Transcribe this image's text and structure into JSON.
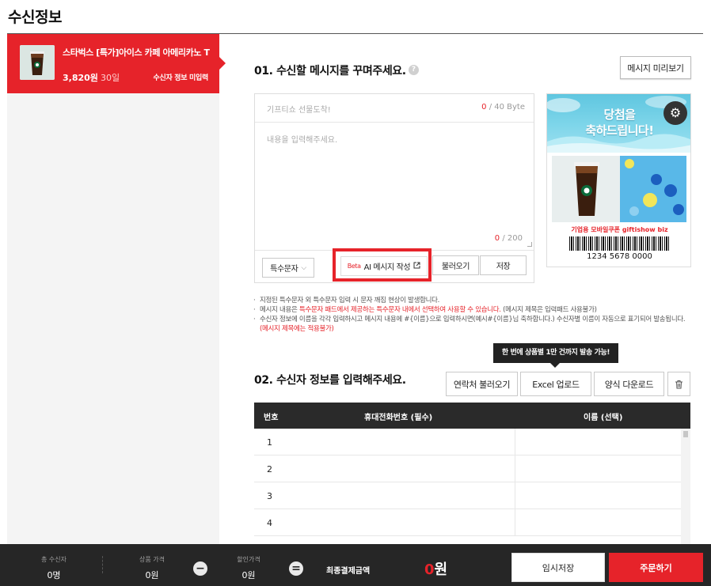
{
  "page": {
    "title": "수신정보"
  },
  "product": {
    "name": "스타벅스 [특가]아이스 카페 아메리카노 T",
    "price": "3,820원",
    "qty": "30일",
    "status": "수신자 정보 미입력"
  },
  "section1": {
    "title": "01. 수신할 메시지를 꾸며주세요.",
    "help_icon": "question-icon",
    "preview_button": "메시지 미리보기",
    "subject_placeholder": "기프티쇼 선물도착!",
    "byte_current": "0",
    "byte_max": " / 40 Byte",
    "body_placeholder": "내용을 입력해주세요.",
    "char_current": "0",
    "char_max": " / 200",
    "special_char_button": "특수문자",
    "ai_beta": "Beta",
    "ai_button": "AI 메시지 작성",
    "load_button": "불러오기",
    "save_button": "저장"
  },
  "card": {
    "banner_line1": "당첨을",
    "banner_line2": "축하드립니다!",
    "logo_text": "기업용 모바일쿠폰  giftishow biz",
    "barcode_number": "1234 5678 0000"
  },
  "notes": {
    "line1": "지정된 특수문자 외 특수문자 입력 시 문자 깨짐 현상이 발생합니다.",
    "line2a": "메시지 내용은 ",
    "line2b": "특수문자 패드에서 제공하는 특수문자 내에서 선택하여 사용할 수 있습니다.",
    "line2c": " (메시지 제목은 입력패드 사용불가)",
    "line3a": "수신자 정보에 이름을 각각 입력하시고 메시지 내용에 #{이름}으로 입력하시면(예시#{이름}님 축하합니다.) 수신자별 이름이 자동으로 표기되어 발송됩니다. ",
    "line3b": "(메시지 제목에는 적용불가)"
  },
  "section2": {
    "title": "02. 수신자 정보를 입력해주세요.",
    "tooltip": "한 번에 상품별 1만 건까지 발송 가능!",
    "contacts_button": "연락처 불러오기",
    "excel_button": "Excel 업로드",
    "form_button": "양식 다운로드",
    "trash_icon": "trash-icon",
    "columns": [
      "번호",
      "휴대전화번호 (필수)",
      "이름 (선택)"
    ],
    "rows": [
      {
        "no": "1",
        "phone": "",
        "name": ""
      },
      {
        "no": "2",
        "phone": "",
        "name": ""
      },
      {
        "no": "3",
        "phone": "",
        "name": ""
      },
      {
        "no": "4",
        "phone": "",
        "name": ""
      }
    ]
  },
  "summary": {
    "recipients_label": "총 수신자",
    "recipients_value": "0명",
    "price_label": "상품 가격",
    "price_value": "0원",
    "discount_label": "할인가격",
    "discount_value": "0원",
    "final_label": "최종결제금액",
    "final_num": "0",
    "final_unit": "원",
    "temp_save_button": "임시저장",
    "order_button": "주문하기"
  },
  "colors": {
    "accent": "#e6232a",
    "dark": "#262626"
  }
}
